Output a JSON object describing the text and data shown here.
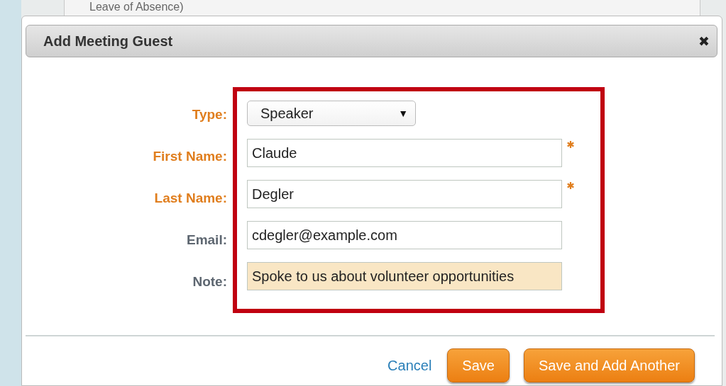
{
  "background": {
    "text": "Leave of Absence)"
  },
  "dialog": {
    "title": "Add Meeting Guest",
    "close": "✖",
    "fields": [
      {
        "kind": "select",
        "label": "Type:",
        "color": "#e07e1e",
        "value": "Speaker",
        "caret": "▼",
        "required": false,
        "focused": false
      },
      {
        "kind": "text",
        "label": "First Name:",
        "color": "#e07e1e",
        "value": "Claude",
        "required": true,
        "focused": false
      },
      {
        "kind": "text",
        "label": "Last Name:",
        "color": "#e07e1e",
        "value": "Degler",
        "required": true,
        "focused": false
      },
      {
        "kind": "text",
        "label": "Email:",
        "color": "#5d6670",
        "value": "cdegler@example.com",
        "required": false,
        "focused": false
      },
      {
        "kind": "text",
        "label": "Note:",
        "color": "#5d6670",
        "value": "Spoke to us about volunteer opportunities",
        "required": false,
        "focused": true
      }
    ],
    "highlighted": true,
    "cancel": "Cancel",
    "buttons": [
      "Save",
      "Save and Add Another"
    ]
  }
}
